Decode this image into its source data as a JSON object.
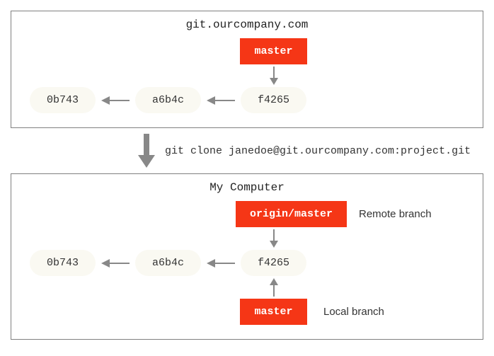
{
  "top": {
    "title": "git.ourcompany.com",
    "branch": "master",
    "commits": [
      "0b743",
      "a6b4c",
      "f4265"
    ]
  },
  "clone_command": "git clone janedoe@git.ourcompany.com:project.git",
  "bottom": {
    "title": "My Computer",
    "remote_branch": "origin/master",
    "remote_label": "Remote branch",
    "local_branch": "master",
    "local_label": "Local branch",
    "commits": [
      "0b743",
      "a6b4c",
      "f4265"
    ]
  }
}
